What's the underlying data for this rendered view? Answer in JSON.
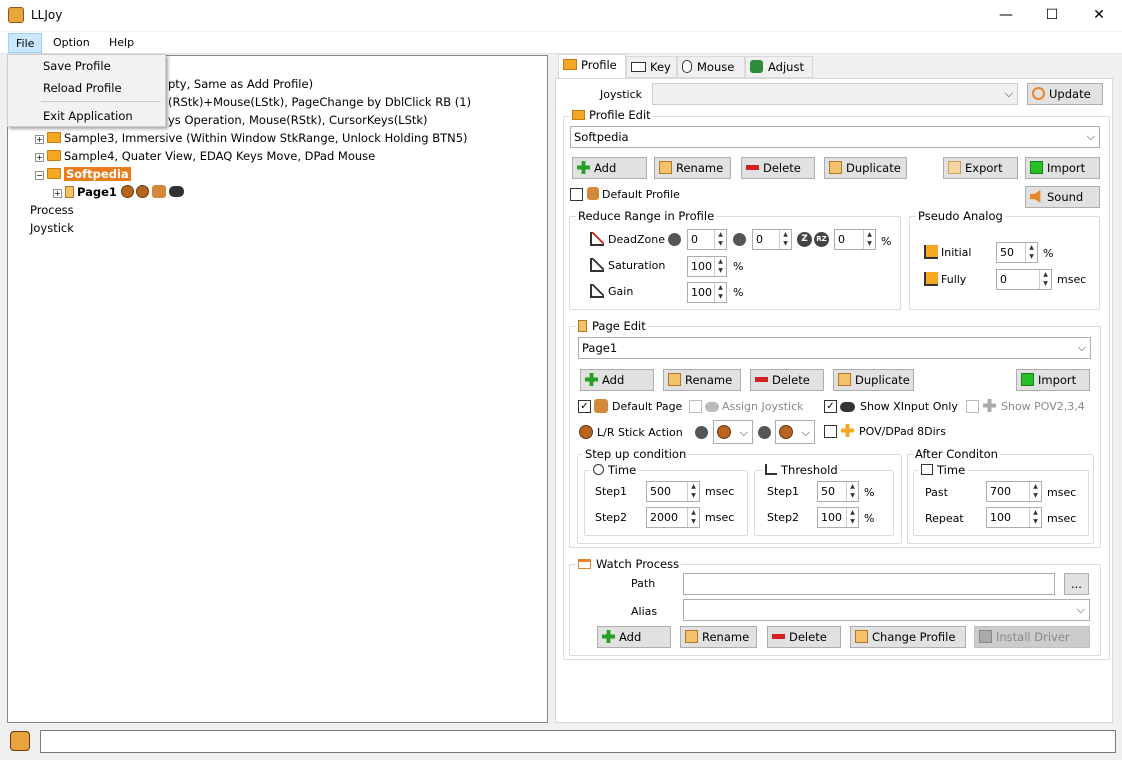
{
  "window": {
    "title": "LLJoy",
    "minimize": "—",
    "maximize": "☐",
    "close": "✕"
  },
  "menu": {
    "file": "File",
    "option": "Option",
    "help": "Help"
  },
  "file_menu": {
    "save": "Save Profile",
    "reload": "Reload Profile",
    "exit": "Exit Application"
  },
  "tree": {
    "node1": "pty, Same as Add Profile)",
    "node2": "(RStk)+Mouse(LStk), PageChange by DblClick RB (1)",
    "node3": "ys Operation, Mouse(RStk), CursorKeys(LStk)",
    "sample3": "Sample3, Immersive (Within Window StkRange, Unlock Holding BTN5)",
    "sample4": "Sample4, Quater View, EDAQ Keys Move, DPad Mouse",
    "softpedia": "Softpedia",
    "page1": "Page1",
    "process": "Process",
    "joystick": "Joystick"
  },
  "tabs": {
    "profile": "Profile",
    "key": "Key",
    "mouse": "Mouse",
    "adjust": "Adjust"
  },
  "profile": {
    "joystick_label": "Joystick",
    "joystick_value": "",
    "update": "Update",
    "profile_edit": "Profile Edit",
    "profile_value": "Softpedia",
    "add": "Add",
    "rename": "Rename",
    "delete": "Delete",
    "duplicate": "Duplicate",
    "export": "Export",
    "import": "Import",
    "sound": "Sound",
    "default_profile": "Default Profile"
  },
  "reduce": {
    "title": "Reduce Range in Profile",
    "deadzone": "DeadZone",
    "dz1": "0",
    "dz2": "0",
    "dz3": "0",
    "pct": "%",
    "z_label": "Z",
    "rz_label": "RZ",
    "saturation": "Saturation",
    "sat": "100",
    "gain": "Gain",
    "gain_val": "100"
  },
  "pseudo": {
    "title": "Pseudo Analog",
    "initial": "Initial",
    "initial_val": "50",
    "pct": "%",
    "fully": "Fully",
    "fully_val": "0",
    "msec": "msec"
  },
  "page_edit": {
    "title": "Page Edit",
    "value": "Page1",
    "add": "Add",
    "rename": "Rename",
    "delete": "Delete",
    "duplicate": "Duplicate",
    "import": "Import",
    "default_page": "Default Page",
    "assign_joystick": "Assign Joystick",
    "show_xinput": "Show XInput Only",
    "show_pov": "Show POV2,3,4",
    "lr_stick": "L/R Stick Action",
    "pov_dpad": "POV/DPad 8Dirs"
  },
  "stepup": {
    "title": "Step up condition",
    "time": "Time",
    "threshold": "Threshold",
    "step1": "Step1",
    "step2": "Step2",
    "t1": "500",
    "t2": "2000",
    "msec": "msec",
    "th1": "50",
    "th2": "100",
    "pct": "%"
  },
  "after": {
    "title": "After Conditon",
    "time": "Time",
    "past": "Past",
    "past_val": "700",
    "repeat": "Repeat",
    "repeat_val": "100",
    "msec": "msec"
  },
  "watch": {
    "title": "Watch Process",
    "path": "Path",
    "path_value": "",
    "browse": "...",
    "alias": "Alias",
    "alias_value": "",
    "add": "Add",
    "rename": "Rename",
    "delete": "Delete",
    "change_profile": "Change Profile",
    "install_driver": "Install Driver"
  },
  "status": {
    "text": ""
  },
  "colors": {
    "selection": "#e87d1e",
    "add_green": "#28a028",
    "delete_red": "#d42020",
    "accent_blue": "#0078d7"
  }
}
